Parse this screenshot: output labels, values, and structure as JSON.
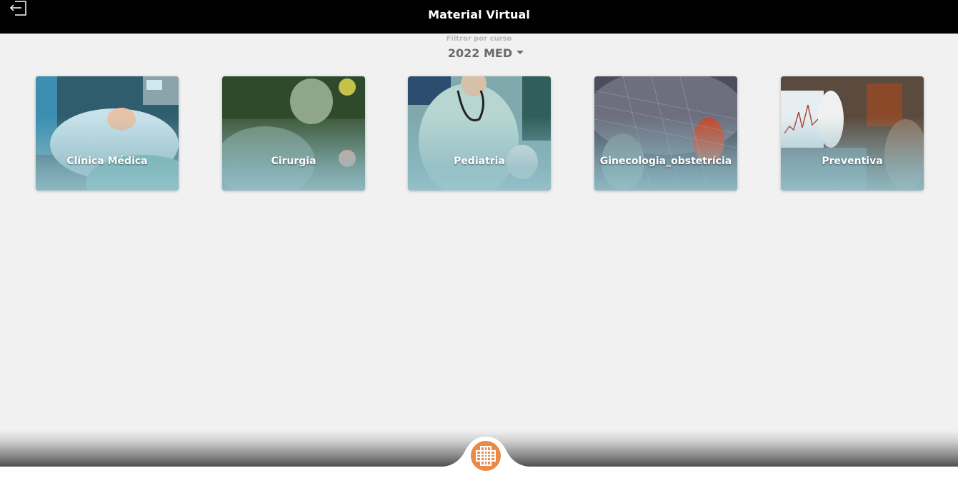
{
  "header": {
    "title": "Material Virtual",
    "exit_icon": "exit-icon"
  },
  "filter": {
    "label": "Filtrar por curso",
    "selected": "2022 MED"
  },
  "cards": [
    {
      "label": "Clínica Médica"
    },
    {
      "label": "Cirurgia"
    },
    {
      "label": "Pediatria"
    },
    {
      "label": "Ginecologia_obstetrícia"
    },
    {
      "label": "Preventiva"
    }
  ],
  "footer": {
    "home_icon": "logo-cross-icon",
    "accent": "#e98a48"
  }
}
